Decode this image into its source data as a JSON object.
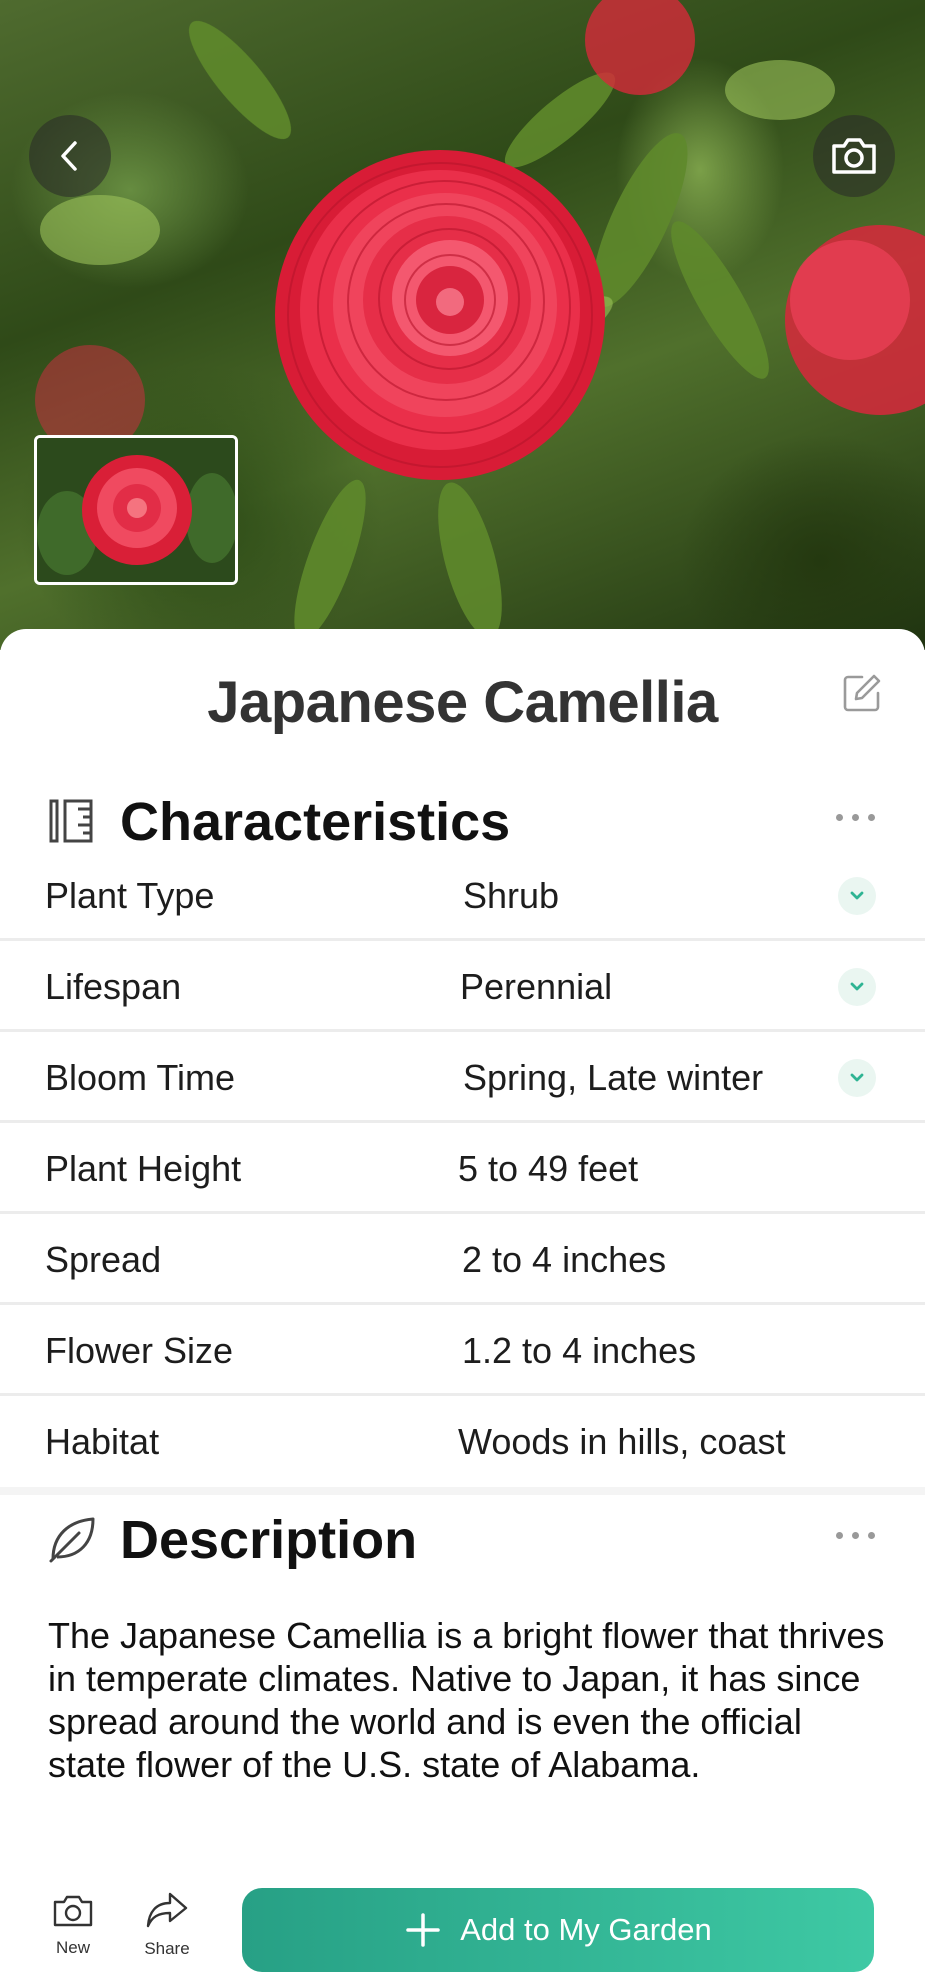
{
  "hero": {
    "back_icon": "chevron-left-icon",
    "camera_icon": "camera-icon"
  },
  "plant": {
    "name": "Japanese Camellia",
    "edit_icon": "edit-icon"
  },
  "characteristics": {
    "title": "Characteristics",
    "icon": "ruler-icon",
    "rows": [
      {
        "label": "Plant Type",
        "value": "Shrub",
        "expandable": true
      },
      {
        "label": "Lifespan",
        "value": "Perennial",
        "expandable": true
      },
      {
        "label": "Bloom Time",
        "value": "Spring, Late winter",
        "expandable": true
      },
      {
        "label": "Plant Height",
        "value": "5 to 49 feet",
        "expandable": false
      },
      {
        "label": "Spread",
        "value": "2 to 4 inches",
        "expandable": false
      },
      {
        "label": "Flower Size",
        "value": "1.2 to 4 inches",
        "expandable": false
      },
      {
        "label": "Habitat",
        "value": "Woods in hills, coast",
        "expandable": false
      }
    ]
  },
  "description": {
    "title": "Description",
    "icon": "leaf-icon",
    "text": "The Japanese Camellia is a bright flower that thrives in temperate climates. Native to Japan, it has since spread around the world and is even the official state flower of the U.S. state of Alabama."
  },
  "bottom_bar": {
    "new_label": "New",
    "share_label": "Share",
    "add_label": "Add to My Garden"
  },
  "colors": {
    "accent": "#2fb493",
    "accent_light": "#eaf6f1"
  }
}
